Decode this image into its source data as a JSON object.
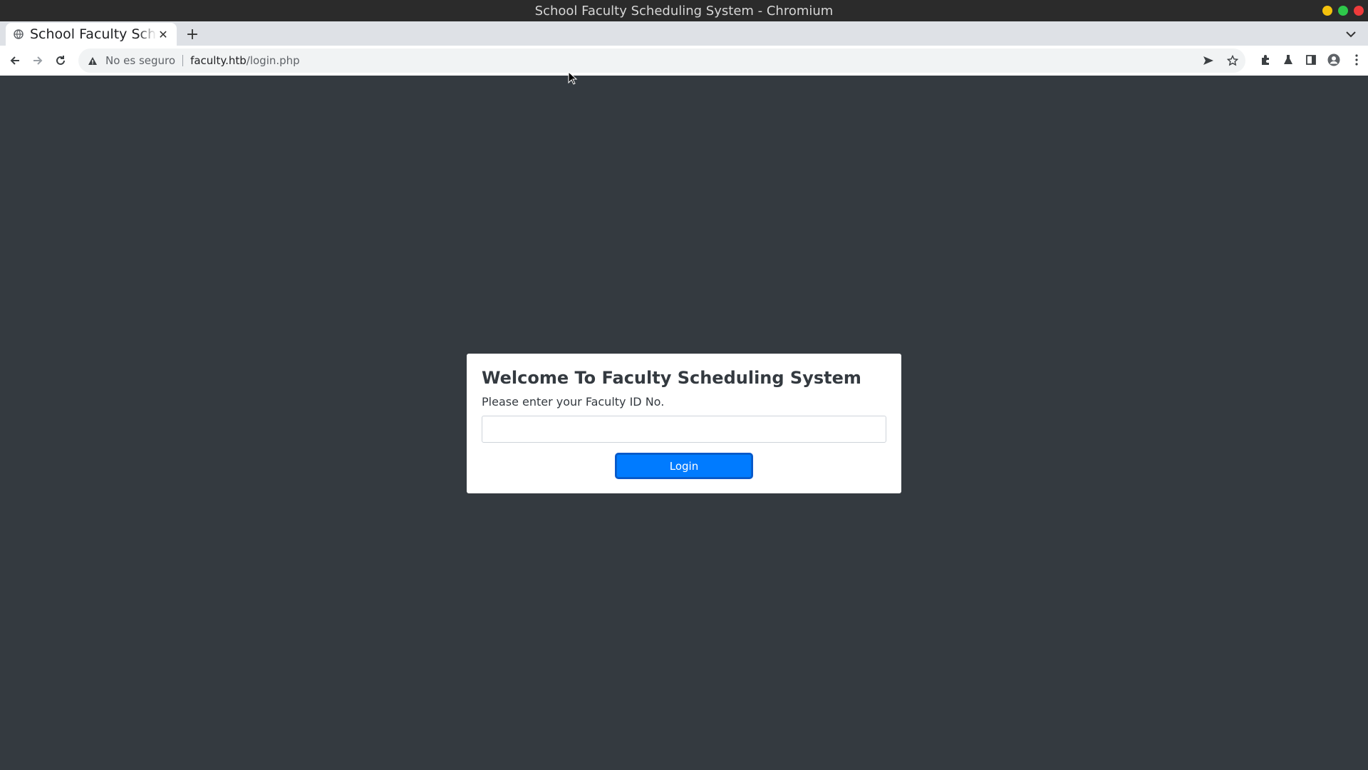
{
  "window": {
    "title": "School Faculty Scheduling System - Chromium"
  },
  "tabs": [
    {
      "title": "School Faculty Scheduling System",
      "icon": "globe-icon"
    }
  ],
  "toolbar": {
    "security_text": "No es seguro",
    "url_host": "faculty.htb",
    "url_path": "/login.php"
  },
  "login": {
    "heading": "Welcome To Faculty Scheduling System",
    "label": "Please enter your Faculty ID No.",
    "input_value": "",
    "input_placeholder": "",
    "button_label": "Login"
  },
  "colors": {
    "page_background": "#343a40",
    "button_primary": "#007bff"
  }
}
